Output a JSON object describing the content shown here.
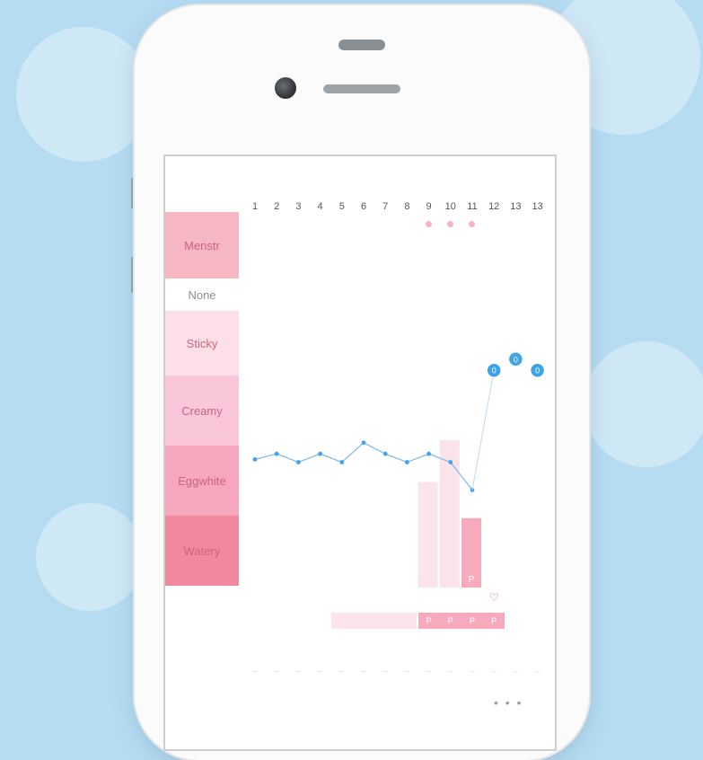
{
  "top_labels": [
    "",
    "",
    "",
    "",
    "",
    "",
    "",
    "",
    "",
    "",
    "",
    "",
    "",
    ""
  ],
  "days": [
    "1",
    "2",
    "3",
    "4",
    "5",
    "6",
    "7",
    "8",
    "9",
    "10",
    "11",
    "12",
    "13",
    "13"
  ],
  "mucus_categories": [
    "Menstr",
    "None",
    "Sticky",
    "Creamy",
    "Eggwhite",
    "Watery"
  ],
  "bbt_values": [
    0.46,
    0.48,
    0.45,
    0.48,
    0.45,
    0.52,
    0.48,
    0.45,
    0.48,
    0.45,
    0.35,
    null,
    null,
    null
  ],
  "temp_markers": [
    {
      "day": "12",
      "label": "0",
      "level": 0.78
    },
    {
      "day": "13",
      "label": "0",
      "level": 0.82
    },
    {
      "day": "13",
      "label": "0",
      "level": 0.78
    }
  ],
  "cervical_bars": [
    {
      "day": "9",
      "level": 0.25
    },
    {
      "day": "10",
      "level": 0.4
    },
    {
      "day": "11",
      "level": 0.12,
      "label": "P"
    }
  ],
  "flow_cells": [
    "P",
    "P",
    "P",
    "P"
  ],
  "symbol": "♡",
  "more_dots": "• • •",
  "colors": {
    "menstr": "#f6b6c4",
    "sticky": "#fcdfe8",
    "creamy": "#f9c6da",
    "eggwhite": "#f6a6bd",
    "watery": "#f1889e",
    "bbt_line": "#7ab8e8",
    "accent_blue": "#3fa3ec"
  },
  "tab_labels": [
    "",
    "",
    "",
    ""
  ]
}
